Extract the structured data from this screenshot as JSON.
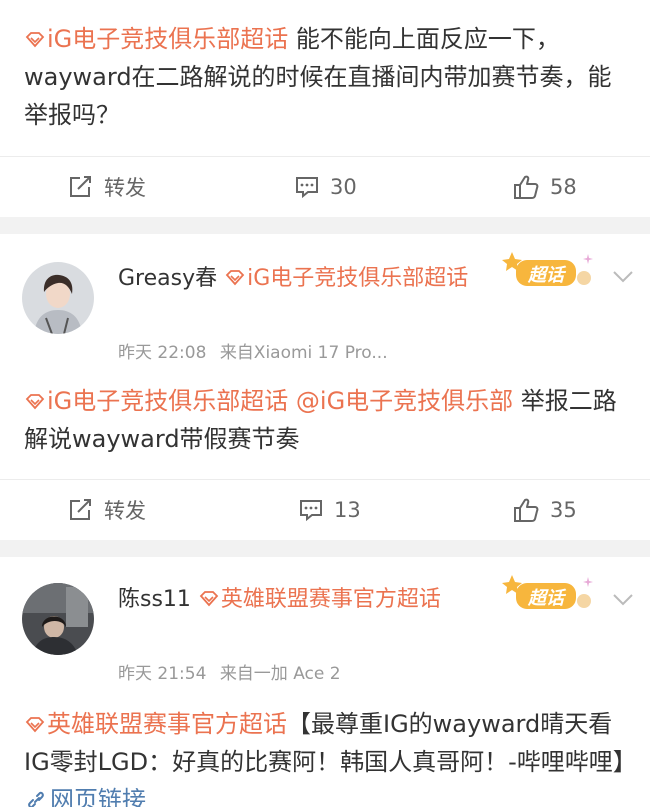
{
  "posts": [
    {
      "text_topic": "iG电子竞技俱乐部超话",
      "text_body": " 能不能向上面反应一下，wayward在二路解说的时候在直播间内带加赛节奏，能举报吗？",
      "repost_label": "转发",
      "comment_count": "30",
      "like_count": "58"
    },
    {
      "user_name": "Greasy春",
      "user_topic": "iG电子竞技俱乐部超话",
      "time": "昨天 22:08",
      "source": "来自Xiaomi 17 Pro...",
      "badge_label": "超话",
      "text_topic": "iG电子竞技俱乐部超话",
      "text_mention": " @iG电子竞技俱乐部",
      "text_body": " 举报二路解说wayward带假赛节奏",
      "repost_label": "转发",
      "comment_count": "13",
      "like_count": "35"
    },
    {
      "user_name": "陈ss11",
      "user_topic": "英雄联盟赛事官方超话",
      "time": "昨天 21:54",
      "source": "来自一加 Ace 2",
      "badge_label": "超话",
      "text_topic": "英雄联盟赛事官方超话",
      "text_body": "【最尊重IG的wayward晴天看IG零封LGD：好真的比赛阿！韩国人真哥阿！-哔哩哔哩】",
      "text_link": "网页链接"
    }
  ],
  "colors": {
    "topic": "#eb7350",
    "link": "#507daf",
    "badge": "#f7b63d"
  }
}
